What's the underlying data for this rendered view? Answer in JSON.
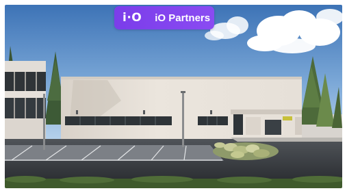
{
  "watermark": {
    "mark": "i·O",
    "name": "iO Partners"
  },
  "colors": {
    "badge": "#7b3dea",
    "sky_top": "#3c74b8",
    "sky_bottom": "#9cc0e2",
    "facade": "#e9e3db",
    "asphalt": "#3f4347"
  }
}
